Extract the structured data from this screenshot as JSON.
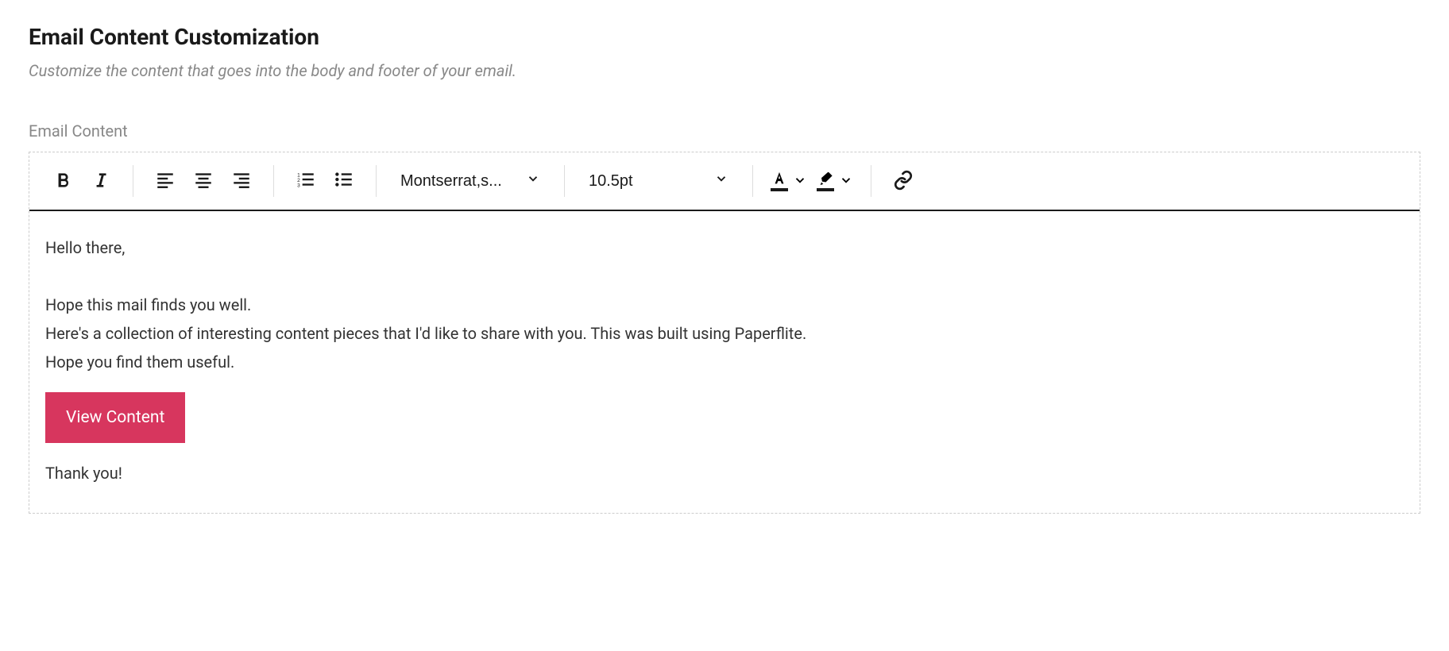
{
  "header": {
    "title": "Email Content Customization",
    "subtitle": "Customize the content that goes into the body and footer of your email."
  },
  "section": {
    "label": "Email Content"
  },
  "toolbar": {
    "font_family": "Montserrat,s...",
    "font_size": "10.5pt"
  },
  "body": {
    "greeting": "Hello there,",
    "line1": "Hope this mail finds you well.",
    "line2": "Here's a collection of interesting content pieces that I'd like to share with you. This was built using Paperflite.",
    "line3": "Hope you find them useful.",
    "cta_label": "View Content",
    "closing": "Thank you!"
  },
  "colors": {
    "primary": "#d7365e"
  }
}
